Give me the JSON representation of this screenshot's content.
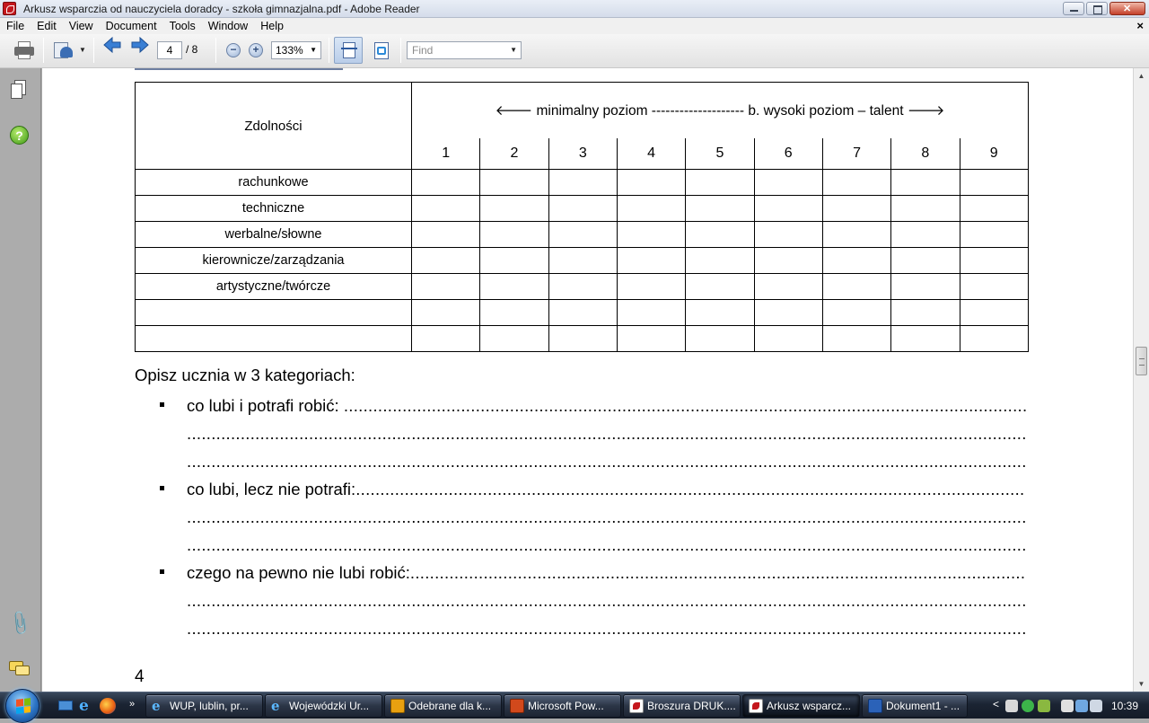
{
  "window": {
    "title": "Arkusz wsparczia od nauczyciela doradcy - szkoła gimnazjalna.pdf - Adobe Reader"
  },
  "menu": {
    "items": [
      "File",
      "Edit",
      "View",
      "Document",
      "Tools",
      "Window",
      "Help"
    ],
    "doc_close": "×"
  },
  "toolbar": {
    "page_current": "4",
    "page_total": "/ 8",
    "zoom": "133%",
    "find_placeholder": "Find"
  },
  "nav": {
    "help_glyph": "?"
  },
  "document": {
    "table": {
      "header_label": "Zdolności",
      "scale_text": "🡐 minimalny poziom -------------------- b. wysoki poziom – talent 🡒",
      "levels": [
        "1",
        "2",
        "3",
        "4",
        "5",
        "6",
        "7",
        "8",
        "9"
      ],
      "rows": [
        "rachunkowe",
        "techniczne",
        "werbalne/słowne",
        "kierownicze/zarządzania",
        "artystyczne/twórcze",
        "",
        ""
      ]
    },
    "description": {
      "heading": "Opisz ucznia w 3 kategoriach:",
      "items": [
        {
          "label": "co lubi i potrafi robić: "
        },
        {
          "label": "co lubi, lecz nie potrafi:"
        },
        {
          "label": "czego na pewno nie lubi robić:"
        }
      ]
    },
    "page_number": "4"
  },
  "taskbar": {
    "quicklaunch_more": "»",
    "buttons": [
      {
        "label": "WUP, lublin, pr...",
        "icon": "ie-icon"
      },
      {
        "label": "Wojewódzki Ur...",
        "icon": "ie-icon"
      },
      {
        "label": "Odebrane dla k...",
        "icon": "outlook-icon"
      },
      {
        "label": "Microsoft Pow...",
        "icon": "powerpoint-icon"
      },
      {
        "label": "Broszura DRUK....",
        "icon": "pdf-icon"
      },
      {
        "label": "Arkusz wsparcz...",
        "icon": "pdf-icon"
      },
      {
        "label": "Dokument1 - ...",
        "icon": "word-icon"
      }
    ],
    "clock": "10:39",
    "tray_chevron": "<"
  }
}
